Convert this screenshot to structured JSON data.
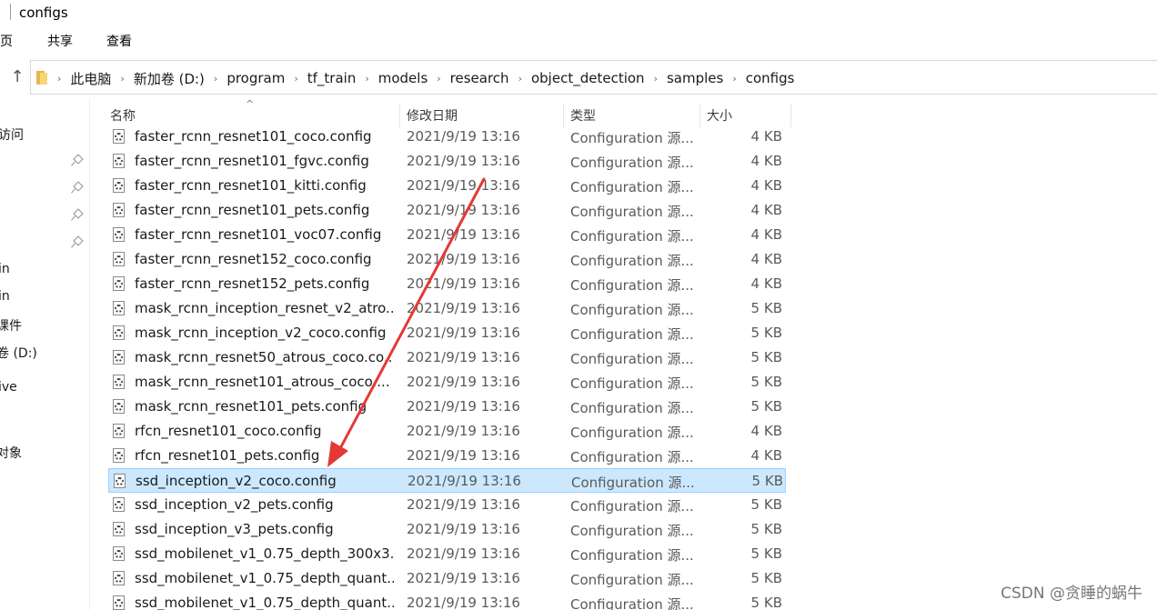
{
  "window": {
    "title": "configs"
  },
  "ribbon": {
    "tabs": [
      "主页",
      "共享",
      "查看"
    ]
  },
  "address": {
    "up_symbol": "↑",
    "crumbs": [
      "此电脑",
      "新加卷 (D:)",
      "program",
      "tf_train",
      "models",
      "research",
      "object_detection",
      "samples",
      "configs"
    ]
  },
  "nav": {
    "items": [
      "访问",
      "in",
      "in",
      "课件",
      "卷 (D:)",
      "ive",
      "",
      "对象"
    ]
  },
  "columns": {
    "name": "名称",
    "date": "修改日期",
    "type": "类型",
    "size": "大小",
    "sort_glyph": "^"
  },
  "files": [
    {
      "name": "faster_rcnn_resnet101_coco.config",
      "date": "2021/9/19 13:16",
      "type": "Configuration 源...",
      "size": "4 KB"
    },
    {
      "name": "faster_rcnn_resnet101_fgvc.config",
      "date": "2021/9/19 13:16",
      "type": "Configuration 源...",
      "size": "4 KB"
    },
    {
      "name": "faster_rcnn_resnet101_kitti.config",
      "date": "2021/9/19 13:16",
      "type": "Configuration 源...",
      "size": "4 KB"
    },
    {
      "name": "faster_rcnn_resnet101_pets.config",
      "date": "2021/9/19 13:16",
      "type": "Configuration 源...",
      "size": "4 KB"
    },
    {
      "name": "faster_rcnn_resnet101_voc07.config",
      "date": "2021/9/19 13:16",
      "type": "Configuration 源...",
      "size": "4 KB"
    },
    {
      "name": "faster_rcnn_resnet152_coco.config",
      "date": "2021/9/19 13:16",
      "type": "Configuration 源...",
      "size": "4 KB"
    },
    {
      "name": "faster_rcnn_resnet152_pets.config",
      "date": "2021/9/19 13:16",
      "type": "Configuration 源...",
      "size": "4 KB"
    },
    {
      "name": "mask_rcnn_inception_resnet_v2_atro...",
      "date": "2021/9/19 13:16",
      "type": "Configuration 源...",
      "size": "5 KB"
    },
    {
      "name": "mask_rcnn_inception_v2_coco.config",
      "date": "2021/9/19 13:16",
      "type": "Configuration 源...",
      "size": "5 KB"
    },
    {
      "name": "mask_rcnn_resnet50_atrous_coco.co...",
      "date": "2021/9/19 13:16",
      "type": "Configuration 源...",
      "size": "5 KB"
    },
    {
      "name": "mask_rcnn_resnet101_atrous_coco....",
      "date": "2021/9/19 13:16",
      "type": "Configuration 源...",
      "size": "5 KB"
    },
    {
      "name": "mask_rcnn_resnet101_pets.config",
      "date": "2021/9/19 13:16",
      "type": "Configuration 源...",
      "size": "5 KB"
    },
    {
      "name": "rfcn_resnet101_coco.config",
      "date": "2021/9/19 13:16",
      "type": "Configuration 源...",
      "size": "4 KB"
    },
    {
      "name": "rfcn_resnet101_pets.config",
      "date": "2021/9/19 13:16",
      "type": "Configuration 源...",
      "size": "4 KB"
    },
    {
      "name": "ssd_inception_v2_coco.config",
      "date": "2021/9/19 13:16",
      "type": "Configuration 源...",
      "size": "5 KB",
      "selected": true
    },
    {
      "name": "ssd_inception_v2_pets.config",
      "date": "2021/9/19 13:16",
      "type": "Configuration 源...",
      "size": "5 KB"
    },
    {
      "name": "ssd_inception_v3_pets.config",
      "date": "2021/9/19 13:16",
      "type": "Configuration 源...",
      "size": "5 KB"
    },
    {
      "name": "ssd_mobilenet_v1_0.75_depth_300x3...",
      "date": "2021/9/19 13:16",
      "type": "Configuration 源...",
      "size": "5 KB"
    },
    {
      "name": "ssd_mobilenet_v1_0.75_depth_quant...",
      "date": "2021/9/19 13:16",
      "type": "Configuration 源...",
      "size": "5 KB"
    },
    {
      "name": "ssd_mobilenet_v1_0.75_depth_quant...",
      "date": "2021/9/19 13:16",
      "type": "Configuration 源...",
      "size": "5 KB"
    }
  ],
  "annotation": {
    "arrow_color": "#e53935"
  },
  "watermark": "CSDN @贪睡的蜗牛",
  "colors": {
    "selected_bg": "#cce8ff",
    "selected_border": "#99d1ff"
  }
}
